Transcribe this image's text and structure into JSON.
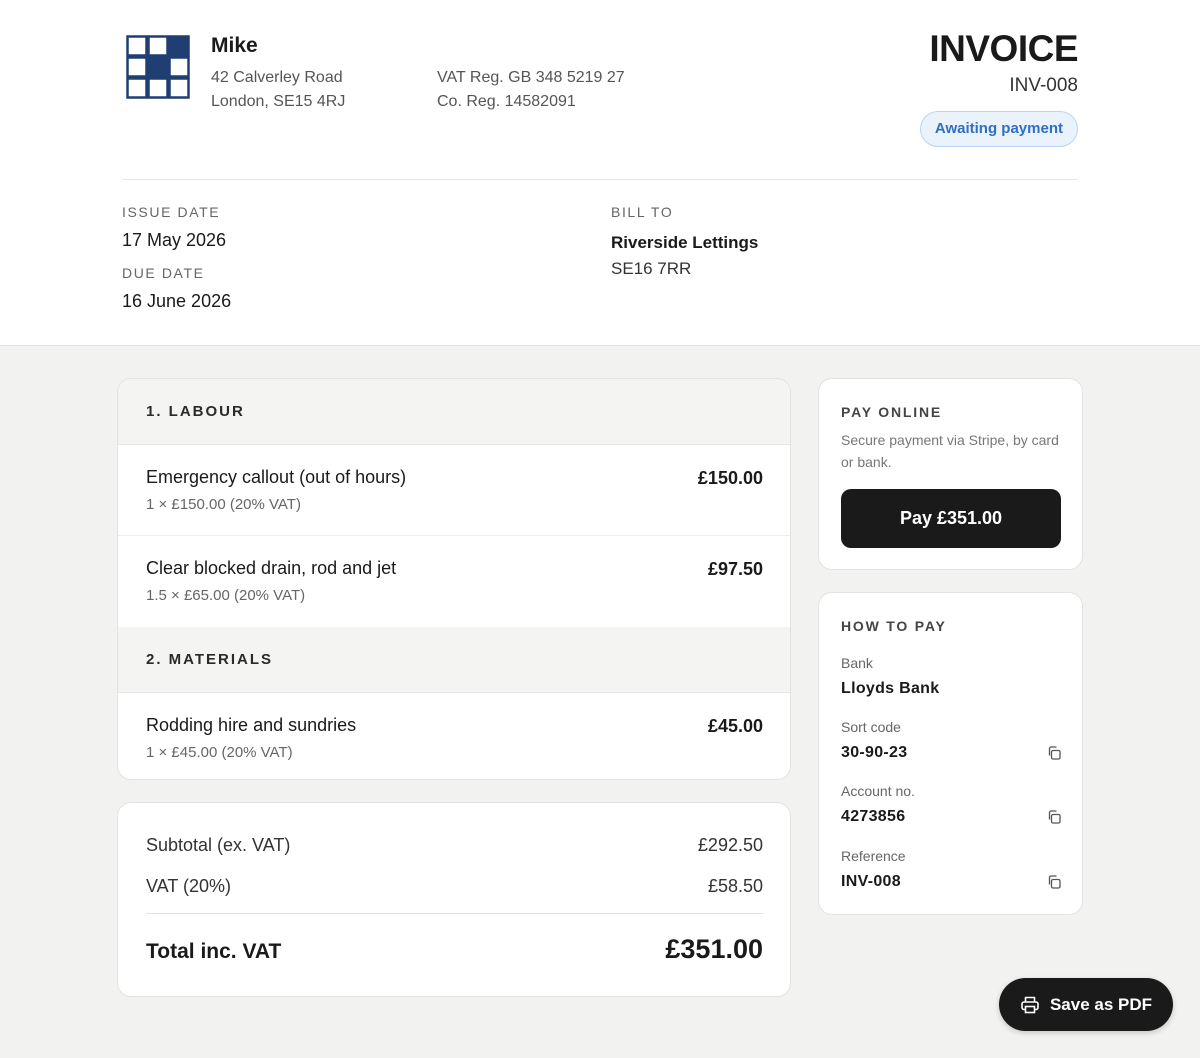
{
  "business": {
    "name": "Mike",
    "address_line1": "42 Calverley Road",
    "address_line2": "London, SE15 4RJ",
    "vat_reg": "VAT Reg. GB 348 5219 27",
    "co_reg": "Co. Reg. 14582091",
    "logo_icon": "grid-logo-icon"
  },
  "invoice": {
    "title": "INVOICE",
    "number": "INV-008",
    "status": "Awaiting payment",
    "status_color": "#2f6fc4"
  },
  "meta": {
    "issue_label": "ISSUE DATE",
    "issue_date": "17 May 2026",
    "due_label": "DUE DATE",
    "due_date": "16 June 2026",
    "bill_to_label": "BILL TO",
    "bill_to_name": "Riverside Lettings",
    "bill_to_postcode": "SE16 7RR"
  },
  "sections": [
    {
      "heading": "1. LABOUR",
      "lines": [
        {
          "description": "Emergency callout (out of hours)",
          "detail": "1 × £150.00 (20% VAT)",
          "amount": "£150.00"
        },
        {
          "description": "Clear blocked drain, rod and jet",
          "detail": "1.5 × £65.00 (20% VAT)",
          "amount": "£97.50"
        }
      ]
    },
    {
      "heading": "2. MATERIALS",
      "lines": [
        {
          "description": "Rodding hire and sundries",
          "detail": "1 × £45.00 (20% VAT)",
          "amount": "£45.00"
        }
      ]
    }
  ],
  "totals": {
    "subtotal_label": "Subtotal (ex. VAT)",
    "subtotal": "£292.50",
    "vat_label": "VAT (20%)",
    "vat": "£58.50",
    "total_label": "Total inc. VAT",
    "total": "£351.00"
  },
  "pay_online": {
    "title": "PAY ONLINE",
    "description": "Secure payment via Stripe, by card or bank.",
    "button_label": "Pay £351.00"
  },
  "how_to_pay": {
    "title": "HOW TO PAY",
    "bank_label": "Bank",
    "bank": "Lloyds Bank",
    "sort_label": "Sort code",
    "sort_code": "30-90-23",
    "account_label": "Account no.",
    "account_no": "4273856",
    "reference_label": "Reference",
    "reference": "INV-008",
    "copy_icon": "copy-icon"
  },
  "actions": {
    "save_pdf_label": "Save as PDF",
    "print_icon": "printer-icon"
  },
  "colors": {
    "accent": "#1f3f73",
    "dark_button": "#1a1a1a",
    "badge_bg": "#eaf2fc"
  }
}
